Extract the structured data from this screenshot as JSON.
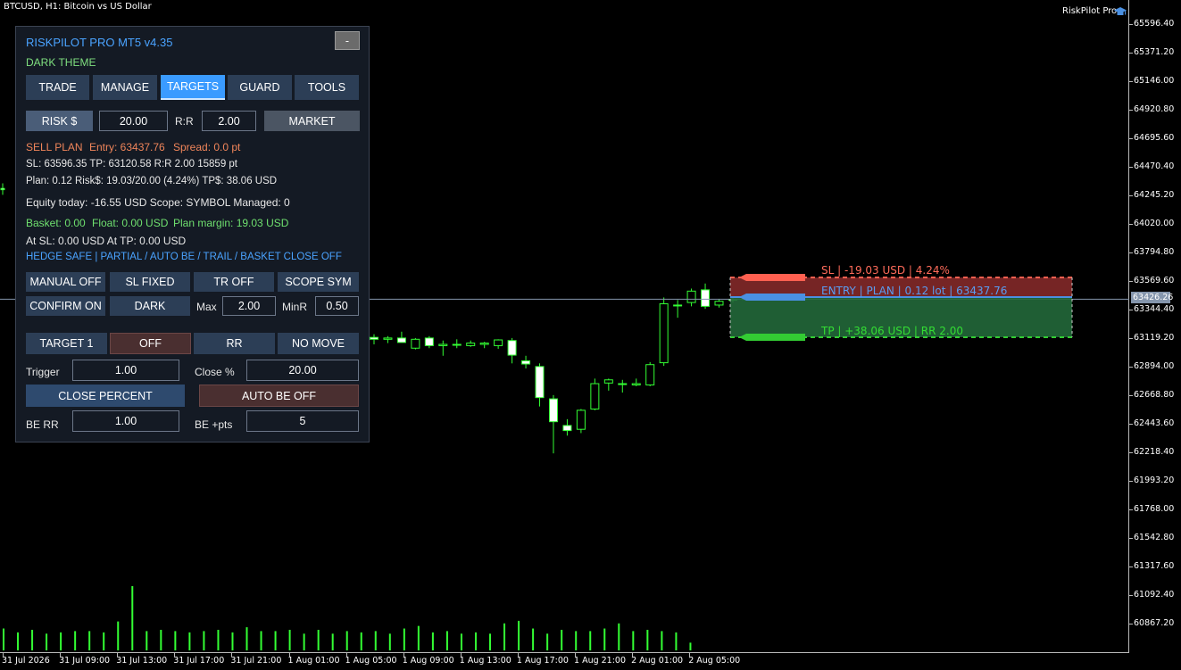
{
  "chart": {
    "title": "BTCUSD, H1:  Bitcoin vs US Dollar",
    "brand": "RiskPilot Pro",
    "brand_icon": "graduation-cap-icon",
    "current_price": "63426.26",
    "price_axis": [
      "65596.40",
      "65371.20",
      "65146.00",
      "64920.80",
      "64695.60",
      "64470.40",
      "64245.20",
      "64020.00",
      "63794.80",
      "63569.60",
      "63344.40",
      "63119.20",
      "62894.00",
      "62668.80",
      "62443.60",
      "62218.40",
      "61993.20",
      "61768.00",
      "61542.80",
      "61317.60",
      "61092.40",
      "60867.20"
    ],
    "time_axis": [
      "31 Jul 2026",
      "31 Jul 09:00",
      "31 Jul 13:00",
      "31 Jul 17:00",
      "31 Jul 21:00",
      "1 Aug 01:00",
      "1 Aug 05:00",
      "1 Aug 09:00",
      "1 Aug 13:00",
      "1 Aug 17:00",
      "1 Aug 21:00",
      "2 Aug 01:00",
      "2 Aug 05:00"
    ],
    "colors": {
      "bull": "#ffffff",
      "bear": "#000000",
      "wick": "#33ff33",
      "volume": "#33ff33",
      "sl": "#ff6050",
      "entry": "#4a90e2",
      "tp": "#33cc33"
    }
  },
  "chart_data": {
    "type": "candlestick",
    "price_range": [
      60700,
      65700
    ],
    "candles": [
      {
        "o": 63125,
        "h": 63150,
        "l": 63070,
        "c": 63110
      },
      {
        "o": 63110,
        "h": 63135,
        "l": 63080,
        "c": 63120
      },
      {
        "o": 63120,
        "h": 63170,
        "l": 63085,
        "c": 63085
      },
      {
        "o": 63040,
        "h": 63120,
        "l": 63030,
        "c": 63110
      },
      {
        "o": 63120,
        "h": 63135,
        "l": 63040,
        "c": 63060
      },
      {
        "o": 63060,
        "h": 63100,
        "l": 62980,
        "c": 63070
      },
      {
        "o": 63070,
        "h": 63110,
        "l": 63040,
        "c": 63065
      },
      {
        "o": 63060,
        "h": 63100,
        "l": 63050,
        "c": 63080
      },
      {
        "o": 63070,
        "h": 63090,
        "l": 63040,
        "c": 63080
      },
      {
        "o": 63060,
        "h": 63110,
        "l": 63035,
        "c": 63105
      },
      {
        "o": 63100,
        "h": 63120,
        "l": 62920,
        "c": 62985
      },
      {
        "o": 62940,
        "h": 62980,
        "l": 62880,
        "c": 62915
      },
      {
        "o": 62895,
        "h": 62920,
        "l": 62580,
        "c": 62650
      },
      {
        "o": 62640,
        "h": 62670,
        "l": 62210,
        "c": 62460
      },
      {
        "o": 62430,
        "h": 62480,
        "l": 62350,
        "c": 62390
      },
      {
        "o": 62400,
        "h": 62560,
        "l": 62370,
        "c": 62550
      },
      {
        "o": 62560,
        "h": 62800,
        "l": 62550,
        "c": 62760
      },
      {
        "o": 62765,
        "h": 62800,
        "l": 62705,
        "c": 62790
      },
      {
        "o": 62760,
        "h": 62790,
        "l": 62690,
        "c": 62760
      },
      {
        "o": 62750,
        "h": 62800,
        "l": 62740,
        "c": 62760
      },
      {
        "o": 62750,
        "h": 62930,
        "l": 62740,
        "c": 62910
      },
      {
        "o": 62925,
        "h": 63440,
        "l": 62900,
        "c": 63390
      },
      {
        "o": 63380,
        "h": 63420,
        "l": 63280,
        "c": 63380
      },
      {
        "o": 63400,
        "h": 63510,
        "l": 63370,
        "c": 63490
      },
      {
        "o": 63500,
        "h": 63550,
        "l": 63350,
        "c": 63370
      },
      {
        "o": 63380,
        "h": 63425,
        "l": 63360,
        "c": 63410
      },
      {
        "o": 63420,
        "h": 63450,
        "l": 63400,
        "c": 63425
      },
      {
        "o": 63425,
        "h": 63440,
        "l": 63415,
        "c": 63430
      }
    ],
    "left_stub": {
      "o": 64300,
      "h": 64340,
      "l": 64250,
      "c": 64290
    },
    "volumes": [
      0.34,
      0.28,
      0.32,
      0.26,
      0.28,
      0.3,
      0.3,
      0.28,
      0.45,
      1.0,
      0.3,
      0.32,
      0.3,
      0.28,
      0.3,
      0.32,
      0.28,
      0.36,
      0.3,
      0.3,
      0.32,
      0.26,
      0.32,
      0.26,
      0.3,
      0.28,
      0.3,
      0.26,
      0.34,
      0.38,
      0.28,
      0.3,
      0.26,
      0.28,
      0.26,
      0.42,
      0.46,
      0.34,
      0.26,
      0.32,
      0.3,
      0.3,
      0.34,
      0.42,
      0.3,
      0.32,
      0.3,
      0.28,
      0.12
    ]
  },
  "zones": {
    "sl_label": "SL | -19.03 USD | 4.24%",
    "entry_label": "ENTRY | PLAN | 0.12 lot | 63437.76",
    "tp_label": "TP | +38.06 USD | RR 2.00"
  },
  "panel": {
    "title": "RISKPILOT PRO MT5  v4.35",
    "minimize": "-",
    "theme": "DARK THEME",
    "tabs": [
      "TRADE",
      "MANAGE",
      "TARGETS",
      "GUARD",
      "TOOLS"
    ],
    "risk_button": "RISK $",
    "risk_value": "20.00",
    "rr_label": "R:R",
    "rr_value": "2.00",
    "market_button": "MARKET",
    "sell_plan": "SELL PLAN",
    "entry": "Entry: 63437.76",
    "spread": "Spread: 0.0 pt",
    "line_sl_tp": "SL: 63596.35   TP: 63120.58   R:R 2.00    15859 pt",
    "line_plan": "Plan: 0.12   Risk$: 19.03/20.00 (4.24%)   TP$: 38.06 USD",
    "line_equity": "Equity today: -16.55 USD   Scope: SYMBOL   Managed: 0",
    "basket": "Basket: 0.00",
    "float": "Float: 0.00 USD",
    "plan_margin": "Plan margin: 19.03 USD",
    "line_at": "At SL: 0.00 USD    At TP: 0.00 USD",
    "hedge_line": "HEDGE SAFE | PARTIAL / AUTO BE / TRAIL / BASKET CLOSE OFF",
    "manual_off": "MANUAL OFF",
    "sl_fixed": "SL FIXED",
    "tr_off": "TR OFF",
    "scope_sym": "SCOPE SYM",
    "confirm_on": "CONFIRM ON",
    "dark": "DARK",
    "max_label": "Max",
    "max_value": "2.00",
    "minr_label": "MinR",
    "minr_value": "0.50",
    "target1": "TARGET 1",
    "off": "OFF",
    "rr": "RR",
    "no_move": "NO MOVE",
    "trigger_label": "Trigger",
    "trigger_value": "1.00",
    "close_pct_label": "Close %",
    "close_pct_value": "20.00",
    "close_percent": "CLOSE PERCENT",
    "auto_be_off": "AUTO BE OFF",
    "be_rr_label": "BE RR",
    "be_rr_value": "1.00",
    "be_pts_label": "BE +pts",
    "be_pts_value": "5"
  }
}
